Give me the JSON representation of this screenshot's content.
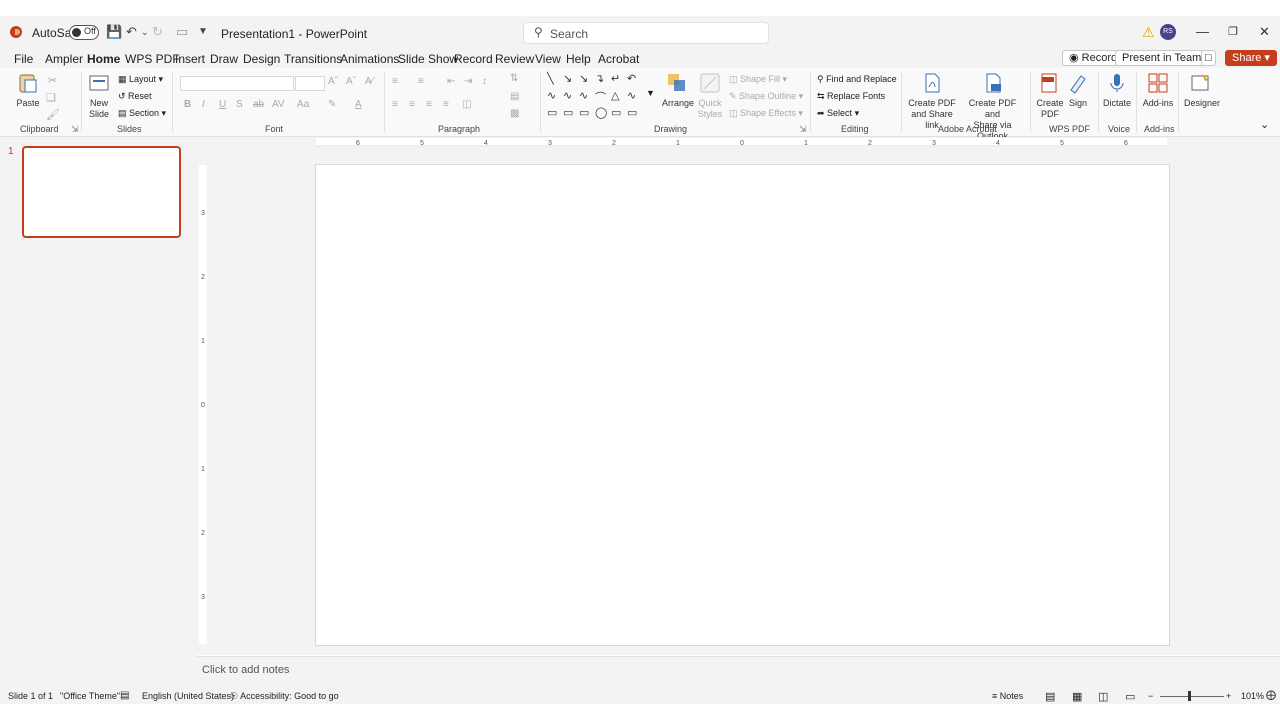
{
  "app": {
    "title": "Presentation1 - PowerPoint",
    "autosave_label": "AutoSave",
    "autosave_state": "Off",
    "search_placeholder": "Search",
    "user_initials": "RS"
  },
  "tabs": [
    "File",
    "Ampler",
    "Home",
    "WPS PDF",
    "Insert",
    "Draw",
    "Design",
    "Transitions",
    "Animations",
    "Slide Show",
    "Record",
    "Review",
    "View",
    "Help",
    "Acrobat"
  ],
  "header_actions": {
    "record": "Record",
    "present_in_teams": "Present in Teams",
    "share": "Share"
  },
  "ribbon": {
    "clipboard": {
      "paste": "Paste",
      "label": "Clipboard"
    },
    "slides": {
      "new_slide_1": "New",
      "new_slide_2": "Slide",
      "layout": "Layout",
      "reset": "Reset",
      "section": "Section",
      "label": "Slides"
    },
    "font": {
      "label": "Font"
    },
    "paragraph": {
      "label": "Paragraph"
    },
    "drawing": {
      "arrange": "Arrange",
      "quick_styles_1": "Quick",
      "quick_styles_2": "Styles",
      "shape_fill": "Shape Fill",
      "shape_outline": "Shape Outline",
      "shape_effects": "Shape Effects",
      "label": "Drawing"
    },
    "editing": {
      "find_replace": "Find and Replace",
      "replace_fonts": "Replace Fonts",
      "select": "Select",
      "label": "Editing"
    },
    "acrobat": {
      "create_pdf_share_1": "Create PDF",
      "create_pdf_share_2": "and Share link",
      "create_pdf_outlook_1": "Create PDF and",
      "create_pdf_outlook_2": "Share via Outlook",
      "label": "Adobe Acrobat"
    },
    "wpspdf": {
      "create_pdf_1": "Create",
      "create_pdf_2": "PDF",
      "sign": "Sign",
      "label": "WPS PDF"
    },
    "voice": {
      "dictate": "Dictate",
      "label": "Voice"
    },
    "addins": {
      "addins": "Add-ins",
      "label": "Add-ins"
    },
    "designer": {
      "designer": "Designer"
    }
  },
  "thumbnail": {
    "number": "1"
  },
  "notes": {
    "placeholder": "Click to add notes"
  },
  "status": {
    "slide": "Slide 1 of 1",
    "theme": "\"Office Theme\"",
    "language": "English (United States)",
    "accessibility": "Accessibility: Good to go",
    "notes": "Notes",
    "zoom": "101%"
  },
  "colors": {
    "accent": "#c43e1c",
    "ribbon_bg": "#f9f9f9",
    "chrome_bg": "#f3f3f3"
  }
}
